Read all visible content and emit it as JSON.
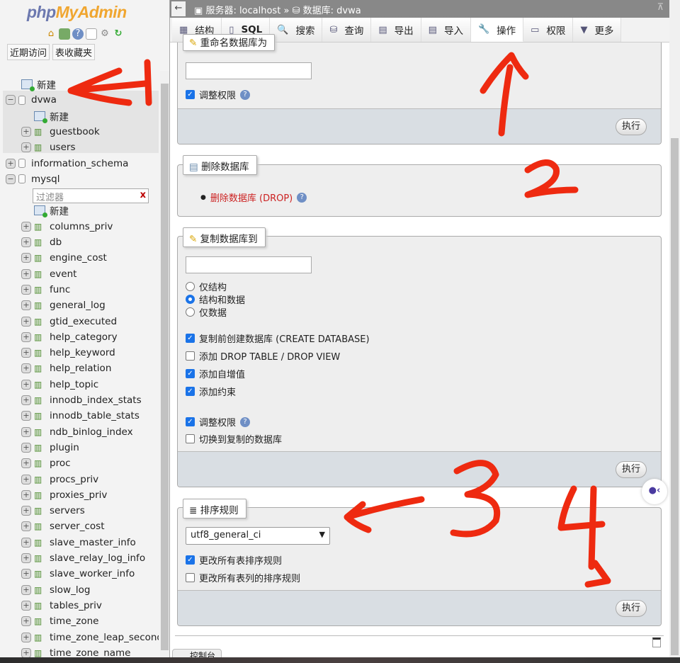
{
  "sidebar": {
    "logo": {
      "part1": "php",
      "part2": "MyAdmin"
    },
    "nav_icons": [
      "home-icon",
      "logout-icon",
      "help-icon",
      "docs-icon",
      "settings-icon",
      "reload-icon"
    ],
    "tabs": [
      "近期访问",
      "表收藏夹"
    ],
    "filter_placeholder": "过滤器",
    "tree": [
      {
        "type": "new",
        "label": "新建",
        "indent": 0
      },
      {
        "type": "db",
        "label": "dvwa",
        "expanded": true,
        "indent": 0
      },
      {
        "type": "new",
        "label": "新建",
        "indent": 1
      },
      {
        "type": "table",
        "label": "guestbook",
        "indent": 1
      },
      {
        "type": "table",
        "label": "users",
        "indent": 1
      },
      {
        "type": "db",
        "label": "information_schema",
        "expanded": false,
        "indent": 0
      },
      {
        "type": "db",
        "label": "mysql",
        "expanded": true,
        "indent": 0
      },
      {
        "type": "filter",
        "label": "",
        "indent": 1
      },
      {
        "type": "new",
        "label": "新建",
        "indent": 1
      },
      {
        "type": "table",
        "label": "columns_priv",
        "indent": 1
      },
      {
        "type": "table",
        "label": "db",
        "indent": 1
      },
      {
        "type": "table",
        "label": "engine_cost",
        "indent": 1
      },
      {
        "type": "table",
        "label": "event",
        "indent": 1
      },
      {
        "type": "table",
        "label": "func",
        "indent": 1
      },
      {
        "type": "table",
        "label": "general_log",
        "indent": 1
      },
      {
        "type": "table",
        "label": "gtid_executed",
        "indent": 1
      },
      {
        "type": "table",
        "label": "help_category",
        "indent": 1
      },
      {
        "type": "table",
        "label": "help_keyword",
        "indent": 1
      },
      {
        "type": "table",
        "label": "help_relation",
        "indent": 1
      },
      {
        "type": "table",
        "label": "help_topic",
        "indent": 1
      },
      {
        "type": "table",
        "label": "innodb_index_stats",
        "indent": 1
      },
      {
        "type": "table",
        "label": "innodb_table_stats",
        "indent": 1
      },
      {
        "type": "table",
        "label": "ndb_binlog_index",
        "indent": 1
      },
      {
        "type": "table",
        "label": "plugin",
        "indent": 1
      },
      {
        "type": "table",
        "label": "proc",
        "indent": 1
      },
      {
        "type": "table",
        "label": "procs_priv",
        "indent": 1
      },
      {
        "type": "table",
        "label": "proxies_priv",
        "indent": 1
      },
      {
        "type": "table",
        "label": "servers",
        "indent": 1
      },
      {
        "type": "table",
        "label": "server_cost",
        "indent": 1
      },
      {
        "type": "table",
        "label": "slave_master_info",
        "indent": 1
      },
      {
        "type": "table",
        "label": "slave_relay_log_info",
        "indent": 1
      },
      {
        "type": "table",
        "label": "slave_worker_info",
        "indent": 1
      },
      {
        "type": "table",
        "label": "slow_log",
        "indent": 1
      },
      {
        "type": "table",
        "label": "tables_priv",
        "indent": 1
      },
      {
        "type": "table",
        "label": "time_zone",
        "indent": 1
      },
      {
        "type": "table",
        "label": "time_zone_leap_second",
        "indent": 1
      },
      {
        "type": "table",
        "label": "time_zone_name",
        "indent": 1
      }
    ]
  },
  "breadcrumb": {
    "back": "←",
    "server": "服务器: localhost",
    "sep": "»",
    "database": "数据库: dvwa",
    "collapse": "⊼"
  },
  "tabs": [
    {
      "label": "结构",
      "icon": "structure-icon",
      "glyph": "▦"
    },
    {
      "label": "SQL",
      "icon": "sql-icon",
      "glyph": "▯"
    },
    {
      "label": "搜索",
      "icon": "search-icon",
      "glyph": "🔍"
    },
    {
      "label": "查询",
      "icon": "query-icon",
      "glyph": "⛁"
    },
    {
      "label": "导出",
      "icon": "export-icon",
      "glyph": "▤"
    },
    {
      "label": "导入",
      "icon": "import-icon",
      "glyph": "▤"
    },
    {
      "label": "操作",
      "icon": "wrench-icon",
      "glyph": "🔧",
      "active": true
    },
    {
      "label": "权限",
      "icon": "privileges-icon",
      "glyph": "▭"
    },
    {
      "label": "更多",
      "icon": "triangle-down-icon",
      "glyph": "▼"
    }
  ],
  "rename": {
    "legend": "重命名数据库为",
    "value": "",
    "adjust_privileges": "调整权限",
    "adjust_checked": true,
    "go": "执行"
  },
  "drop": {
    "legend": "删除数据库",
    "link": "删除数据库 (DROP)",
    "link_color": "#cc2222"
  },
  "copy": {
    "legend": "复制数据库到",
    "value": "",
    "radios": [
      {
        "label": "仅结构",
        "checked": false
      },
      {
        "label": "结构和数据",
        "checked": true
      },
      {
        "label": "仅数据",
        "checked": false
      }
    ],
    "checks": [
      {
        "label": "复制前创建数据库 (CREATE DATABASE)",
        "checked": true
      },
      {
        "label": "添加 DROP TABLE / DROP VIEW",
        "checked": false
      },
      {
        "label": "添加自增值",
        "checked": true
      },
      {
        "label": "添加约束",
        "checked": true
      }
    ],
    "adjust_privileges": "调整权限",
    "adjust_checked": true,
    "switch": "切换到复制的数据库",
    "switch_checked": false,
    "go": "执行"
  },
  "collation": {
    "legend": "排序规则",
    "selected": "utf8_general_ci",
    "checks": [
      {
        "label": "更改所有表排序规则",
        "checked": true
      },
      {
        "label": "更改所有表列的排序规则",
        "checked": false
      }
    ],
    "go": "执行"
  },
  "console": {
    "label": "控制台"
  },
  "annotations": {
    "labels": [
      "1",
      "2",
      "3",
      "4"
    ],
    "color": "#ee2a10"
  }
}
